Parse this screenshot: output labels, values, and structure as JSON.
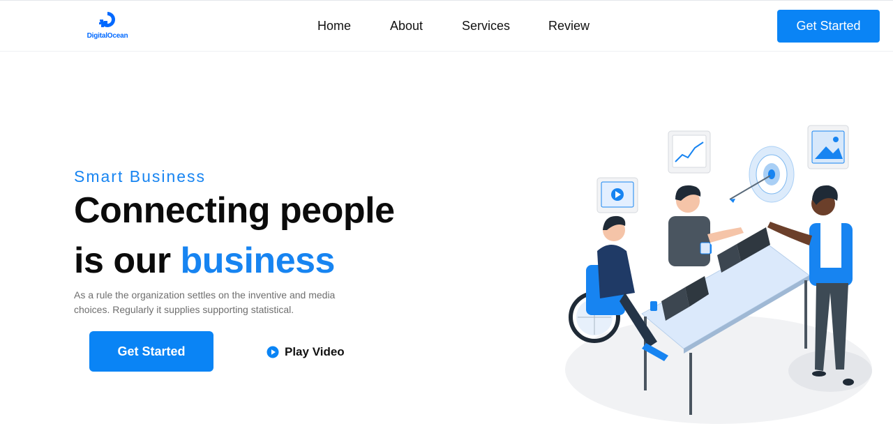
{
  "header": {
    "logo_text": "DigitalOcean",
    "nav": [
      {
        "label": "Home"
      },
      {
        "label": "About"
      },
      {
        "label": "Services"
      },
      {
        "label": "Review"
      }
    ],
    "cta_label": "Get Started"
  },
  "hero": {
    "eyebrow": "Smart Business",
    "headline_line1": "Connecting people",
    "headline_line2_prefix": "is our ",
    "headline_line2_accent": "business",
    "description": "As a rule the organization settles on the inventive and media choices. Regularly it supplies supporting statistical.",
    "primary_cta": "Get Started",
    "secondary_cta": "Play Video"
  },
  "icons": {
    "logo": "digitalocean-logo-icon",
    "play": "play-circle-icon"
  },
  "colors": {
    "accent": "#1784f1",
    "button": "#0a84f5",
    "text": "#111111",
    "muted": "#6e6e6e"
  }
}
